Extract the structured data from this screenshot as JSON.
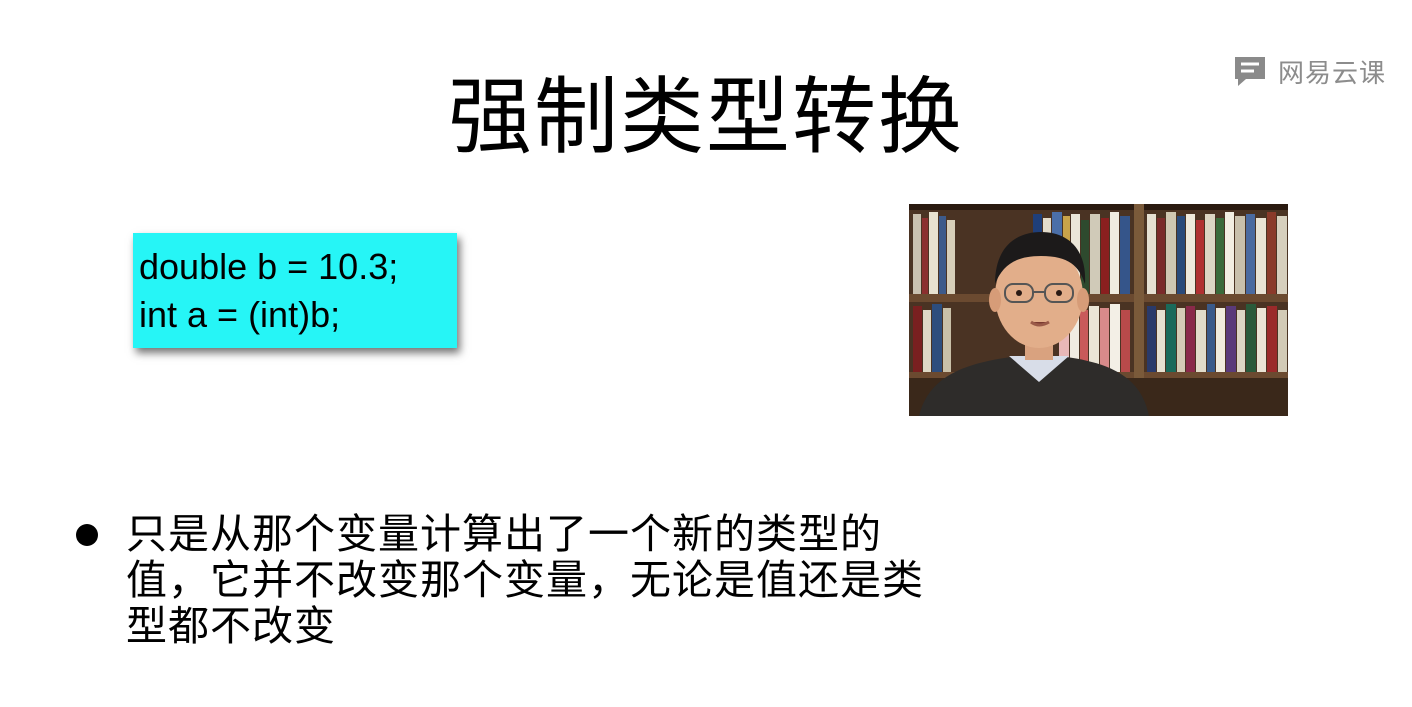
{
  "slide": {
    "title": "强制类型转换",
    "code_lines": [
      "double b = 10.3;",
      "int a = (int)b;"
    ],
    "bullet": "只是从那个变量计算出了一个新的类型的值，它并不改变那个变量，无论是值还是类型都不改变"
  },
  "watermark": {
    "text": "网易云课",
    "icon": "chat-bubble-icon"
  },
  "video": {
    "icon": "lecturer-video"
  },
  "colors": {
    "code_box_bg": "#26f5f6",
    "background": "#ffffff",
    "text": "#000000",
    "watermark": "#8c8c8c"
  }
}
